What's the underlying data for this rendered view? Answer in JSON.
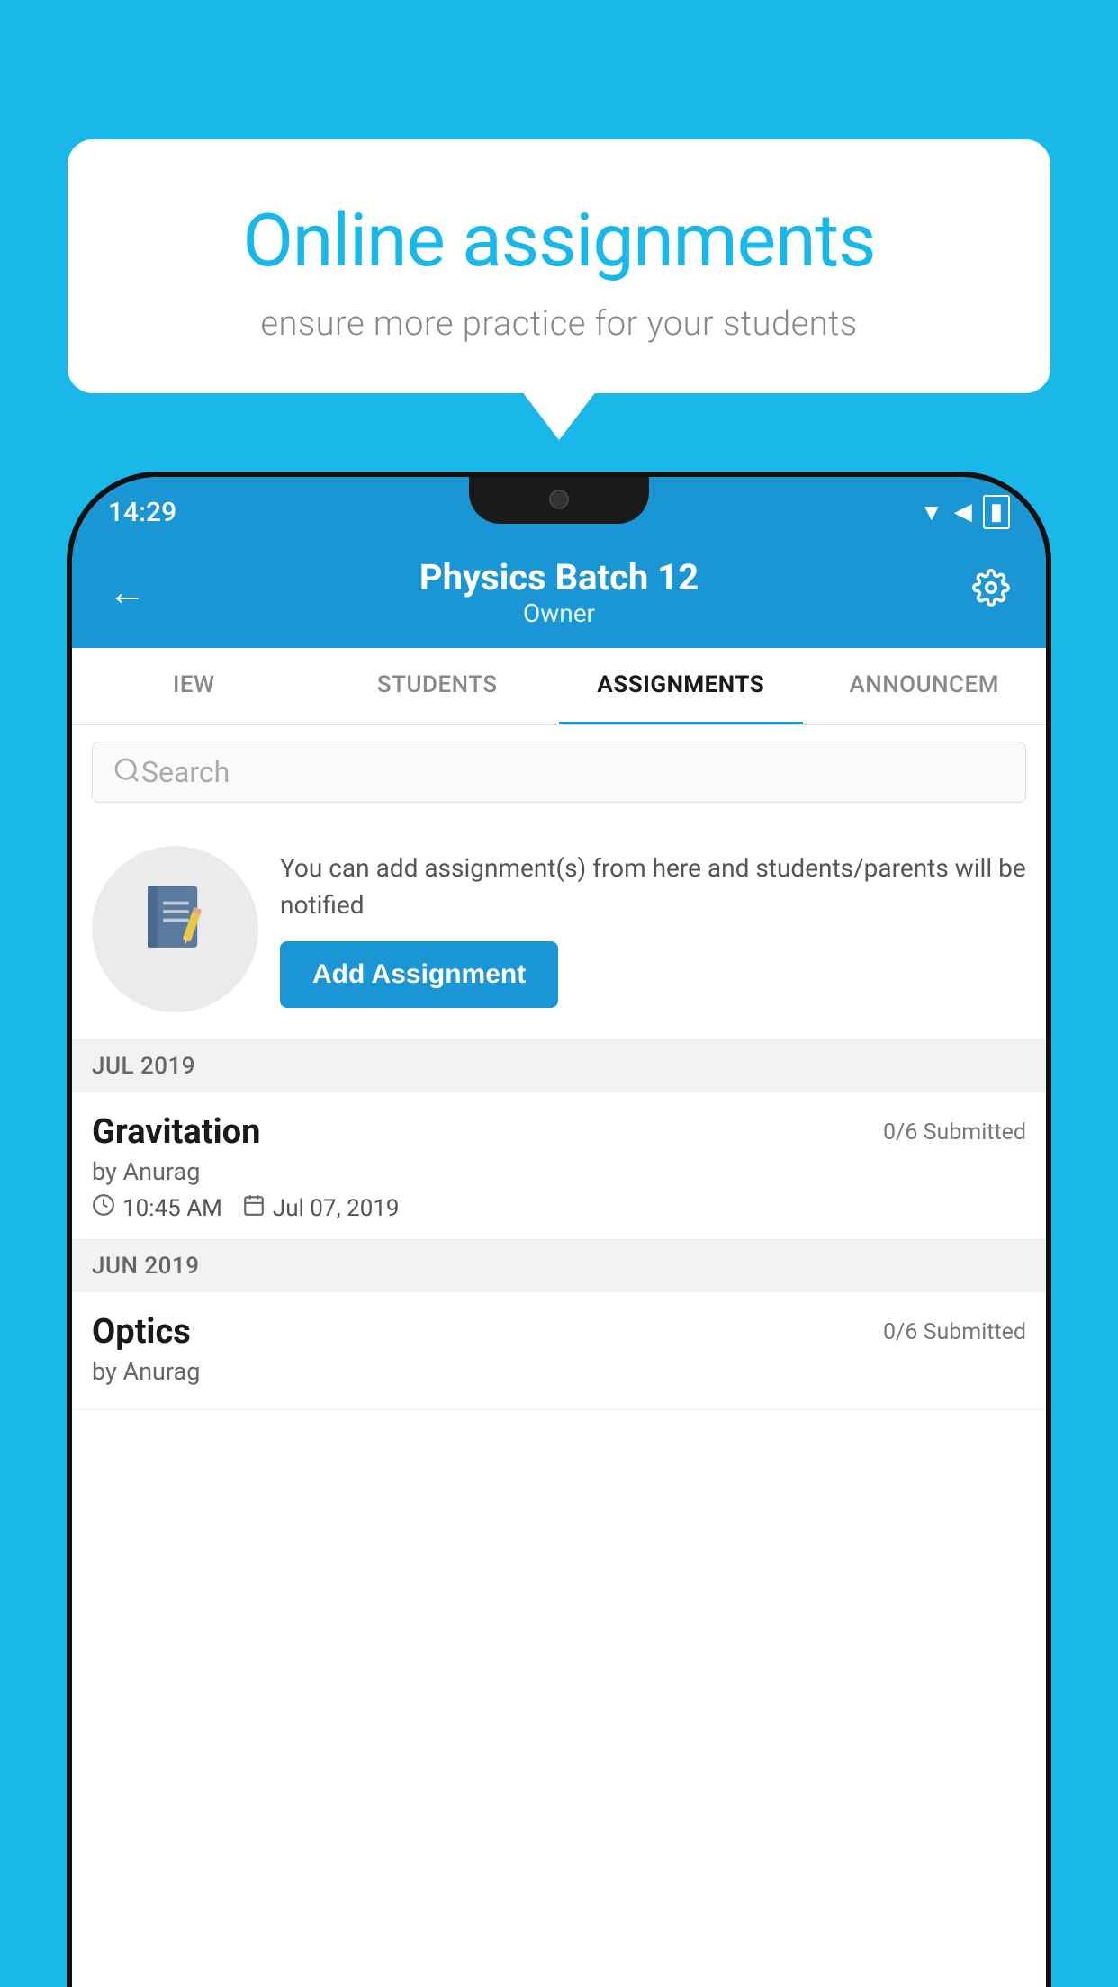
{
  "background_color": "#1ab8e8",
  "speech_bubble": {
    "title": "Online assignments",
    "subtitle": "ensure more practice for your students"
  },
  "status_bar": {
    "time": "14:29",
    "wifi_icon": "wifi",
    "signal_icon": "signal",
    "battery_icon": "battery"
  },
  "app_header": {
    "back_label": "←",
    "title": "Physics Batch 12",
    "subtitle": "Owner",
    "settings_icon": "gear"
  },
  "tabs": [
    {
      "label": "IEW",
      "active": false
    },
    {
      "label": "STUDENTS",
      "active": false
    },
    {
      "label": "ASSIGNMENTS",
      "active": true
    },
    {
      "label": "ANNOUNCEM",
      "active": false
    }
  ],
  "search": {
    "placeholder": "Search"
  },
  "promo": {
    "description": "You can add assignment(s) from here and students/parents will be notified",
    "add_button_label": "Add Assignment"
  },
  "sections": [
    {
      "label": "JUL 2019",
      "assignments": [
        {
          "title": "Gravitation",
          "submitted": "0/6 Submitted",
          "by": "by Anurag",
          "time": "10:45 AM",
          "date": "Jul 07, 2019"
        }
      ]
    },
    {
      "label": "JUN 2019",
      "assignments": [
        {
          "title": "Optics",
          "submitted": "0/6 Submitted",
          "by": "by Anurag",
          "time": "",
          "date": ""
        }
      ]
    }
  ]
}
